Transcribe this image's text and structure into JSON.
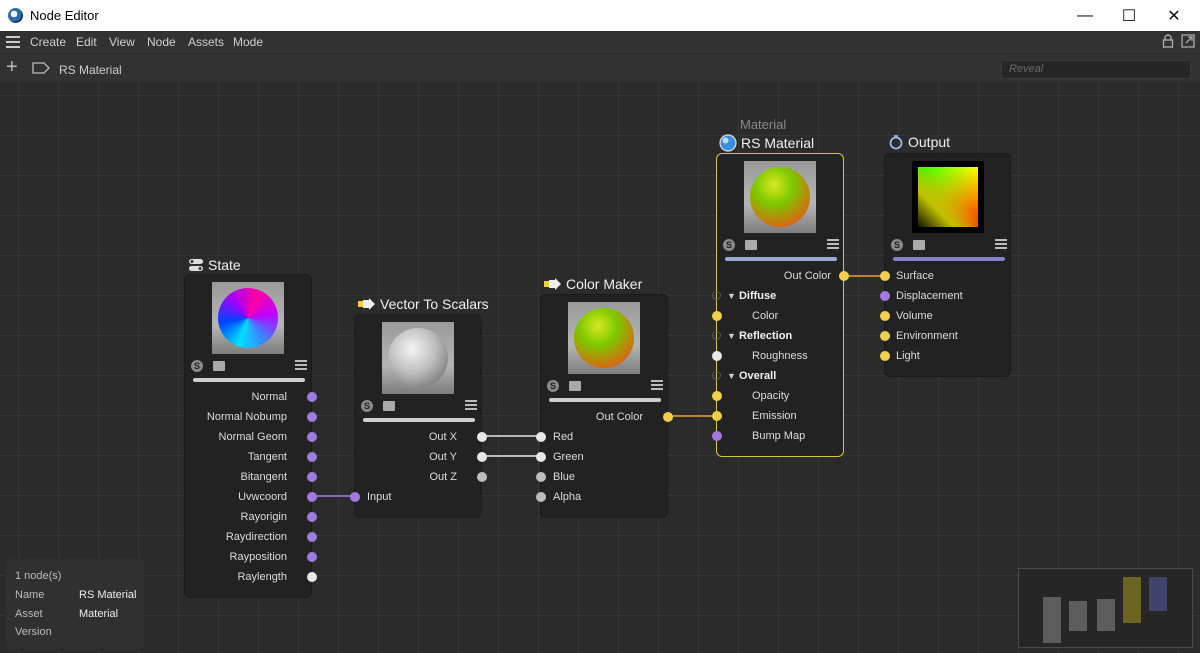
{
  "window": {
    "title": "Node Editor",
    "minimize": "—",
    "maximize": "☐",
    "close": "✕"
  },
  "menu": [
    "Create",
    "Edit",
    "View",
    "Node",
    "Assets",
    "Mode"
  ],
  "breadcrumb": "RS Material",
  "search": {
    "placeholder": "Reveal"
  },
  "nodes": {
    "state": {
      "title": "State",
      "outputs": [
        "Normal",
        "Normal Nobump",
        "Normal Geom",
        "Tangent",
        "Bitangent",
        "Uvwcoord",
        "Rayorigin",
        "Raydirection",
        "Rayposition",
        "Raylength"
      ]
    },
    "vector_to_scalars": {
      "title": "Vector To Scalars",
      "outputs": [
        "Out X",
        "Out Y",
        "Out Z"
      ],
      "inputs": [
        "Input"
      ]
    },
    "color_maker": {
      "title": "Color Maker",
      "output": "Out Color",
      "inputs": [
        "Red",
        "Green",
        "Blue",
        "Alpha"
      ]
    },
    "rs_material": {
      "subtitle": "Material",
      "title": "RS Material",
      "output": "Out Color",
      "groups": {
        "diffuse": "Diffuse",
        "diffuse_color": "Color",
        "reflection": "Reflection",
        "roughness": "Roughness",
        "overall": "Overall",
        "opacity": "Opacity",
        "emission": "Emission",
        "bump_map": "Bump Map"
      }
    },
    "output": {
      "title": "Output",
      "inputs": [
        "Surface",
        "Displacement",
        "Volume",
        "Environment",
        "Light"
      ]
    }
  },
  "info": {
    "count": "1 node(s)",
    "name_label": "Name",
    "name_value": "RS Material",
    "asset_label": "Asset",
    "asset_value": "Material",
    "version_label": "Version"
  },
  "icons": [
    "hamburger-icon",
    "lock-icon",
    "expand-icon",
    "plus-icon",
    "tag-icon"
  ],
  "colors": {
    "selection": "#d8c53a",
    "port_vector": "#a279e0",
    "port_color": "#f0d04a",
    "port_float": "#e8e8e8"
  }
}
